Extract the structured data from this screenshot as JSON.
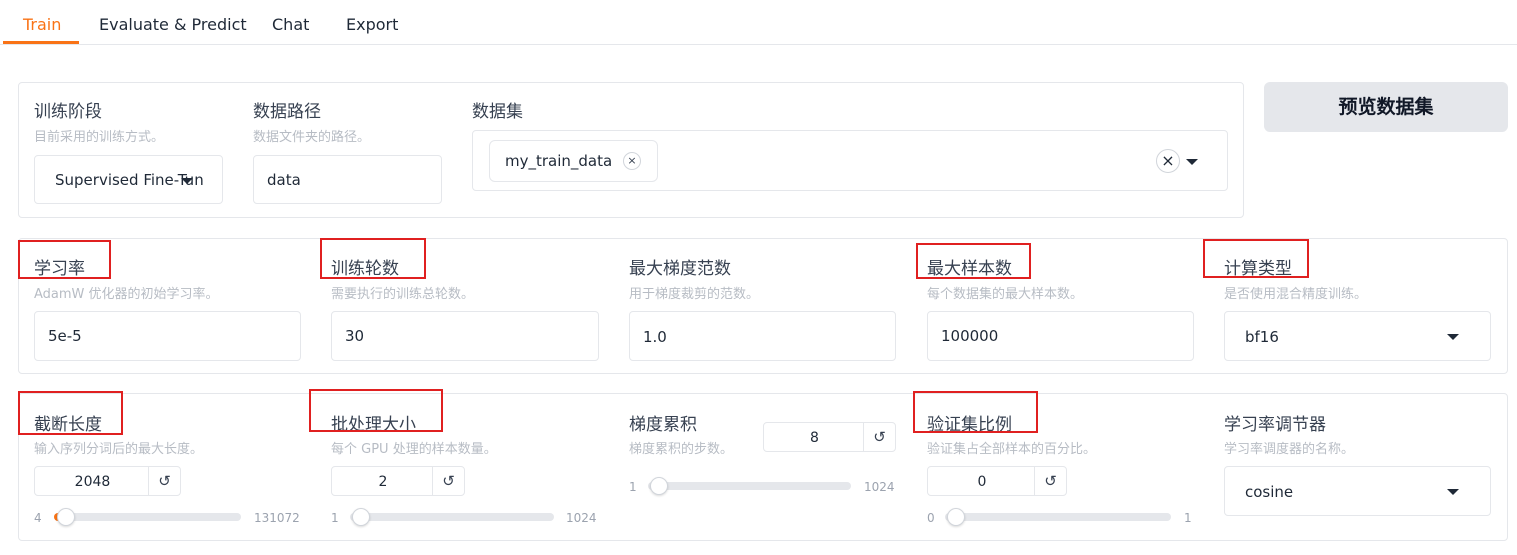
{
  "tabs": [
    {
      "label": "Train",
      "active": true
    },
    {
      "label": "Evaluate & Predict",
      "active": false
    },
    {
      "label": "Chat",
      "active": false
    },
    {
      "label": "Export",
      "active": false
    }
  ],
  "colors": {
    "accent": "#f97316",
    "highlight": "#e02020"
  },
  "top": {
    "stage": {
      "label": "训练阶段",
      "info": "目前采用的训练方式。",
      "value": "Supervised Fine-Tun"
    },
    "dataset_dir": {
      "label": "数据路径",
      "info": "数据文件夹的路径。",
      "value": "data"
    },
    "dataset": {
      "label": "数据集",
      "chips": [
        "my_train_data"
      ]
    },
    "preview_button": "预览数据集"
  },
  "row1": {
    "learning_rate": {
      "label": "学习率",
      "info": "AdamW 优化器的初始学习率。",
      "value": "5e-5"
    },
    "epochs": {
      "label": "训练轮数",
      "info": "需要执行的训练总轮数。",
      "value": "30"
    },
    "max_grad_norm": {
      "label": "最大梯度范数",
      "info": "用于梯度裁剪的范数。",
      "value": "1.0"
    },
    "max_samples": {
      "label": "最大样本数",
      "info": "每个数据集的最大样本数。",
      "value": "100000"
    },
    "compute_type": {
      "label": "计算类型",
      "info": "是否使用混合精度训练。",
      "value": "bf16"
    }
  },
  "row2": {
    "cutoff_len": {
      "label": "截断长度",
      "info": "输入序列分词后的最大长度。",
      "value": "2048",
      "min": "4",
      "max": "131072",
      "fraction": 0.0156
    },
    "batch_size": {
      "label": "批处理大小",
      "info": "每个 GPU 处理的样本数量。",
      "value": "2",
      "min": "1",
      "max": "1024",
      "fraction": 0.001
    },
    "grad_accum": {
      "label": "梯度累积",
      "info": "梯度累积的步数。",
      "value": "8",
      "min": "1",
      "max": "1024",
      "fraction": 0.007
    },
    "val_size": {
      "label": "验证集比例",
      "info": "验证集占全部样本的百分比。",
      "value": "0",
      "min": "0",
      "max": "1",
      "fraction": 0.0
    },
    "lr_scheduler": {
      "label": "学习率调节器",
      "info": "学习率调度器的名称。",
      "value": "cosine"
    }
  },
  "icons": {
    "reset": "↺",
    "close": "×",
    "caret": "chevron-down-icon"
  }
}
